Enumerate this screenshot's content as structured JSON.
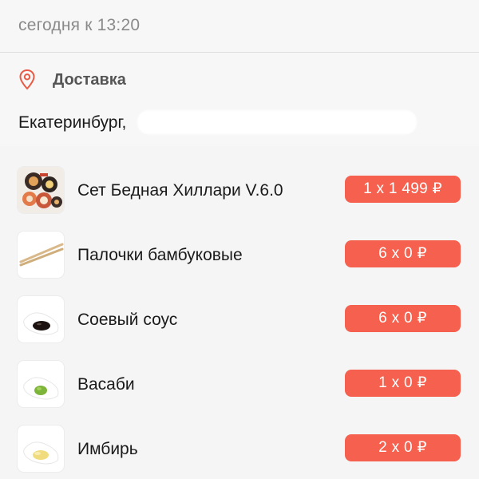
{
  "header": {
    "time_label": "сегодня к 13:20"
  },
  "delivery": {
    "title": "Доставка",
    "address": "Екатеринбург,",
    "pin_icon": "location-pin-icon",
    "accent_color": "#e85a45"
  },
  "order": {
    "badge_color": "#f5614e",
    "items": [
      {
        "name": "Сет Бедная Хиллари V.6.0",
        "qty": "1 x 1 499 ₽",
        "icon": "sushi-set-icon"
      },
      {
        "name": "Палочки бамбуковые",
        "qty": "6 x 0 ₽",
        "icon": "chopsticks-icon"
      },
      {
        "name": "Соевый соус",
        "qty": "6 x 0 ₽",
        "icon": "soy-sauce-icon"
      },
      {
        "name": "Васаби",
        "qty": "1 x 0 ₽",
        "icon": "wasabi-icon"
      },
      {
        "name": "Имбирь",
        "qty": "2 x 0 ₽",
        "icon": "ginger-icon"
      }
    ]
  }
}
